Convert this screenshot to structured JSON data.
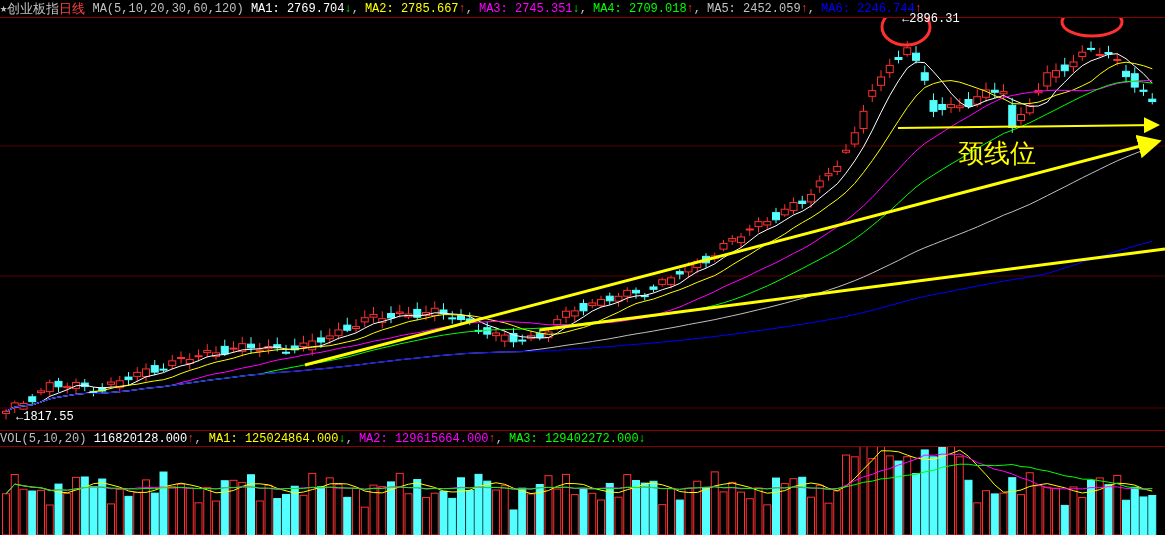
{
  "header": {
    "star": "★",
    "title": "创业板指",
    "period": "日线",
    "ma_legend": "MA(5,10,20,30,60,120)",
    "ma": [
      {
        "label": "MA1:",
        "value": "2769.704",
        "arrow": "↓",
        "rising": false,
        "sep": ",",
        "color": "#ffffff"
      },
      {
        "label": "MA2:",
        "value": "2785.667",
        "arrow": "↑",
        "rising": true,
        "sep": ",",
        "color": "#ffff00"
      },
      {
        "label": "MA3:",
        "value": "2745.351",
        "arrow": "↓",
        "rising": false,
        "sep": ",",
        "color": "#ff00ff"
      },
      {
        "label": "MA4:",
        "value": "2709.018",
        "arrow": "↑",
        "rising": true,
        "sep": ",",
        "color": "#00ff00"
      },
      {
        "label": "MA5:",
        "value": "2452.059",
        "arrow": "↑",
        "rising": true,
        "sep": ",",
        "color": "#c0c0c0"
      },
      {
        "label": "MA6:",
        "value": "2246.744",
        "arrow": "↑",
        "rising": true,
        "color": "#0000ff"
      }
    ]
  },
  "chart": {
    "high_label": "←2896.31",
    "low_label": "←1817.55",
    "annotation": "颈线位"
  },
  "volume": {
    "legend": "VOL(5,10,20)",
    "value": "116820128.000",
    "arrow": "↑",
    "rising": true,
    "sep": ",",
    "ma": [
      {
        "label": "MA1:",
        "value": "125024864.000",
        "arrow": "↓",
        "rising": false,
        "sep": ",",
        "color": "#ffff00"
      },
      {
        "label": "MA2:",
        "value": "129615664.000",
        "arrow": "↑",
        "rising": true,
        "sep": ",",
        "color": "#ff00ff"
      },
      {
        "label": "MA3:",
        "value": "129402272.000",
        "arrow": "↓",
        "rising": false,
        "color": "#00ff00"
      }
    ]
  }
}
